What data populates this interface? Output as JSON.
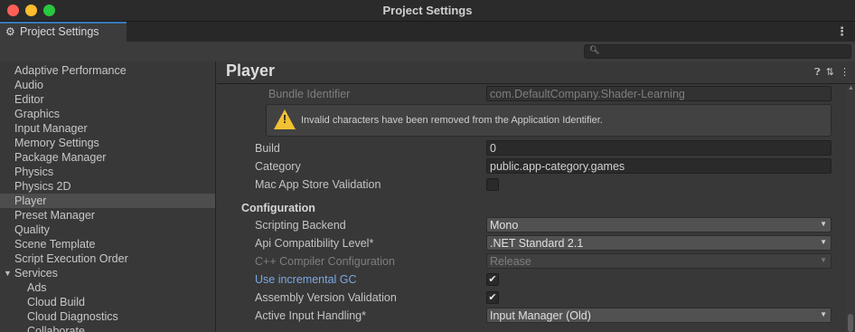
{
  "window": {
    "title": "Project Settings"
  },
  "tab": {
    "label": "Project Settings"
  },
  "sidebar": {
    "items": [
      {
        "label": "Adaptive Performance"
      },
      {
        "label": "Audio"
      },
      {
        "label": "Editor"
      },
      {
        "label": "Graphics"
      },
      {
        "label": "Input Manager"
      },
      {
        "label": "Memory Settings"
      },
      {
        "label": "Package Manager"
      },
      {
        "label": "Physics"
      },
      {
        "label": "Physics 2D"
      },
      {
        "label": "Player"
      },
      {
        "label": "Preset Manager"
      },
      {
        "label": "Quality"
      },
      {
        "label": "Scene Template"
      },
      {
        "label": "Script Execution Order"
      },
      {
        "label": "Services"
      },
      {
        "label": "Ads"
      },
      {
        "label": "Cloud Build"
      },
      {
        "label": "Cloud Diagnostics"
      },
      {
        "label": "Collaborate"
      }
    ],
    "selected": "Player"
  },
  "main": {
    "title": "Player",
    "bundle_identifier": {
      "label": "Bundle Identifier",
      "value": "com.DefaultCompany.Shader-Learning"
    },
    "warning": {
      "text": "Invalid characters have been removed from the Application Identifier."
    },
    "build": {
      "label": "Build",
      "value": "0"
    },
    "category": {
      "label": "Category",
      "value": "public.app-category.games"
    },
    "mac_app_store": {
      "label": "Mac App Store Validation",
      "checked": false
    },
    "configuration": {
      "header": "Configuration"
    },
    "scripting_backend": {
      "label": "Scripting Backend",
      "value": "Mono"
    },
    "api_compat": {
      "label": "Api Compatibility Level*",
      "value": ".NET Standard 2.1"
    },
    "cpp_compiler": {
      "label": "C++ Compiler Configuration",
      "value": "Release"
    },
    "incremental_gc": {
      "label": "Use incremental GC",
      "checked": true
    },
    "assembly_validation": {
      "label": "Assembly Version Validation",
      "checked": true
    },
    "input_handling": {
      "label": "Active Input Handling*",
      "value": "Input Manager (Old)"
    }
  },
  "colors": {
    "background": "#383838",
    "accent": "#3a79bb",
    "link": "#7ba8e0",
    "warning": "#f2c233"
  }
}
